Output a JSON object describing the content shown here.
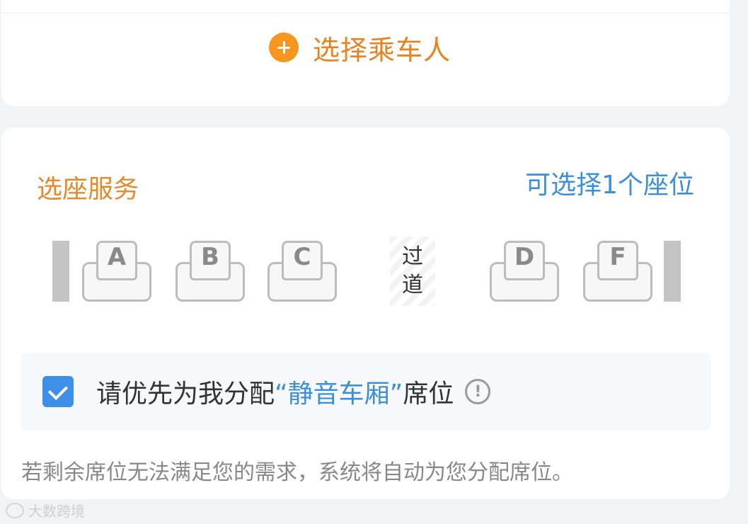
{
  "passenger": {
    "add_label": "选择乘车人"
  },
  "seat_service": {
    "title": "选座服务",
    "hint": "可选择1个座位",
    "seats_left": [
      {
        "letter": "A"
      },
      {
        "letter": "B"
      },
      {
        "letter": "C"
      }
    ],
    "aisle_label_1": "过",
    "aisle_label_2": "道",
    "seats_right": [
      {
        "letter": "D"
      },
      {
        "letter": "F"
      }
    ],
    "quiet_option": {
      "checked": true,
      "text_before": "请优先为我分配",
      "highlight": "“静音车厢”",
      "text_after": "席位",
      "info_icon": "!"
    },
    "notice": "若剩余席位无法满足您的需求，系统将自动为您分配席位。"
  },
  "watermark": {
    "text": "大数跨境"
  },
  "colors": {
    "accent_orange": "#f7951f",
    "accent_blue": "#3d8fd8",
    "checkbox_blue": "#3d8fe8"
  }
}
